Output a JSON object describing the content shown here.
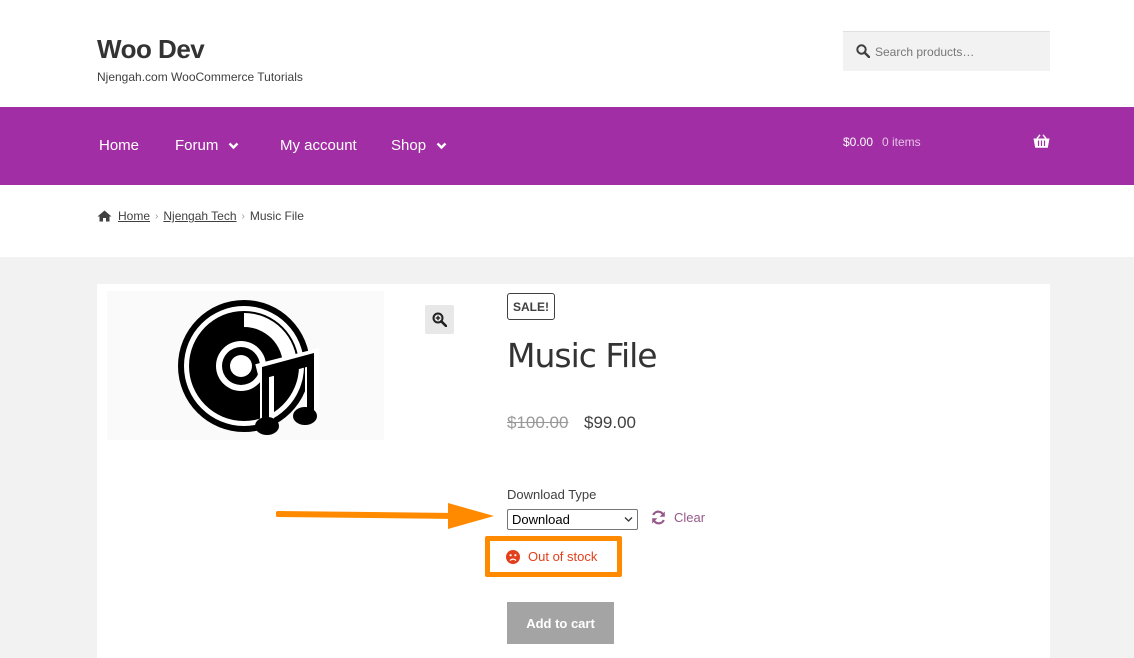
{
  "site": {
    "title": "Woo Dev",
    "tagline": "Njengah.com WooCommerce Tutorials"
  },
  "search": {
    "placeholder": "Search products…",
    "icon": "search-icon"
  },
  "nav": {
    "items": [
      {
        "label": "Home",
        "has_dropdown": false
      },
      {
        "label": "Forum",
        "has_dropdown": true
      },
      {
        "label": "My account",
        "has_dropdown": false
      },
      {
        "label": "Shop",
        "has_dropdown": true
      }
    ],
    "cart_total": "$0.00",
    "cart_count": "0 items",
    "background": "#a12ea4"
  },
  "breadcrumb": {
    "items": [
      "Home",
      "Njengah Tech",
      "Music File"
    ]
  },
  "product": {
    "badge": "SALE!",
    "title": "Music File",
    "price_old": "$100.00",
    "price_new": "$99.00",
    "variation_label": "Download Type",
    "variation_value": "Download",
    "reset_label": "Clear",
    "stock_status": "Out of stock",
    "add_to_cart": "Add to cart"
  },
  "colors": {
    "accent": "#a12ea4",
    "annotation": "#ff8a00",
    "out_of_stock": "#e2401c",
    "link": "#96588a"
  }
}
